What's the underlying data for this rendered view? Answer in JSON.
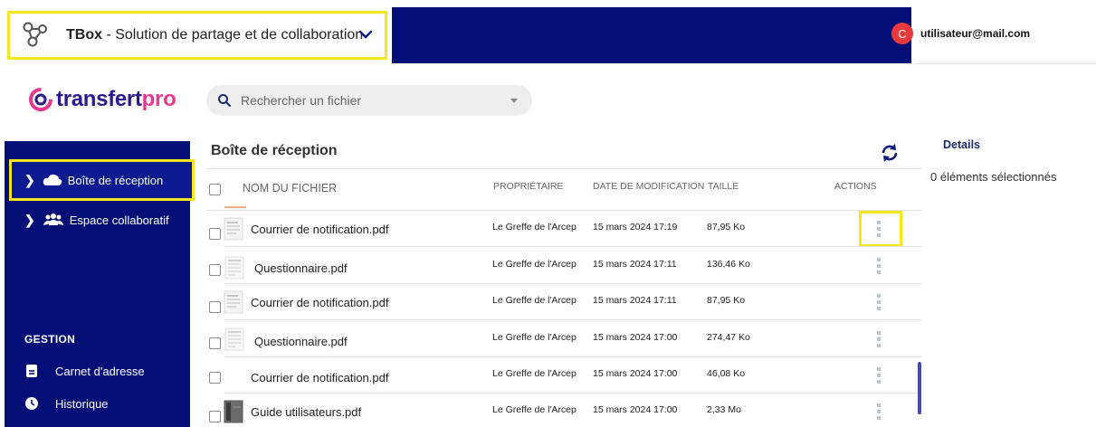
{
  "header": {
    "app_title_bold": "TBox",
    "app_title_rest": " - Solution de partage et de collaboration",
    "user_initial": "C",
    "user_email": "utilisateur@mail.com"
  },
  "brand": {
    "part1": "transfert",
    "part2": "pro"
  },
  "search": {
    "placeholder": "Rechercher un fichier"
  },
  "sidebar": {
    "items": [
      {
        "label": "Boîte de réception"
      },
      {
        "label": "Espace collaboratif"
      }
    ],
    "section_title": "GESTION",
    "links": [
      {
        "label": "Carnet d'adresse"
      },
      {
        "label": "Historique"
      }
    ]
  },
  "main": {
    "title": "Boîte de réception",
    "columns": {
      "name": "NOM DU FICHIER",
      "owner": "PROPRIÉTAIRE",
      "modified": "DATE DE MODIFICATION",
      "size": "TAILLE",
      "actions": "ACTIONS"
    },
    "rows": [
      {
        "name": "Courrier de notification.pdf",
        "owner": "Le Greffe de l'Arcep",
        "date": "15 mars 2024 17:19",
        "size": "87,95 Ko"
      },
      {
        "name": "Questionnaire.pdf",
        "owner": "Le Greffe de l'Arcep",
        "date": "15 mars 2024 17:11",
        "size": "136,46 Ko"
      },
      {
        "name": "Courrier de notification.pdf",
        "owner": "Le Greffe de l'Arcep",
        "date": "15 mars 2024 17:11",
        "size": "87,95 Ko"
      },
      {
        "name": "Questionnaire.pdf",
        "owner": "Le Greffe de l'Arcep",
        "date": "15 mars 2024 17:00",
        "size": "274,47 Ko"
      },
      {
        "name": "Courrier de notification.pdf",
        "owner": "Le Greffe de l'Arcep",
        "date": "15 mars 2024 17:00",
        "size": "46,08 Ko"
      },
      {
        "name": "Guide utilisateurs.pdf",
        "owner": "Le Greffe de l'Arcep",
        "date": "15 mars 2024 17:00",
        "size": "2,33 Mo"
      }
    ]
  },
  "details": {
    "title": "Details",
    "selection_count": "0 éléments sélectionnés"
  },
  "colors": {
    "navy": "#030f77",
    "highlight": "#f5e61e",
    "avatar": "#e83a3a",
    "brand_purple": "#2b1a8c",
    "brand_pink": "#e8388f"
  }
}
